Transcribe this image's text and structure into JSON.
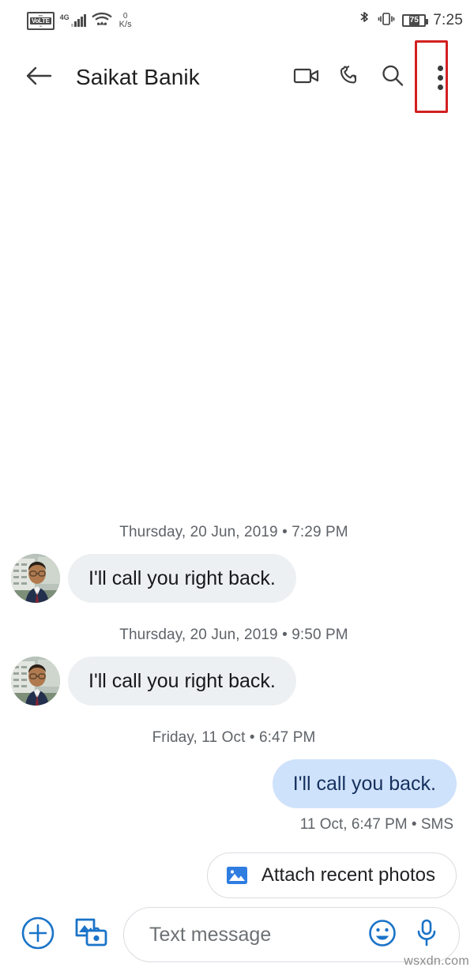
{
  "status_bar": {
    "volte_label_top": "VoLTE",
    "volte_label": "VoLTE",
    "network": "4G",
    "data_rate_value": "0",
    "data_rate_unit": "K/s",
    "battery_level": "75",
    "time": "7:25",
    "icons": [
      "volte-icon",
      "signal-icon",
      "wifi-icon",
      "bluetooth-icon",
      "vibrate-icon",
      "battery-icon"
    ]
  },
  "toolbar": {
    "back_icon": "back-arrow-icon",
    "title": "Saikat Banik",
    "video_call_icon": "video-call-icon",
    "call_icon": "phone-call-icon",
    "search_icon": "search-icon",
    "overflow_icon": "more-options-icon",
    "highlight_color": "#d32020"
  },
  "conversation": {
    "groups": [
      {
        "separator": "Thursday, 20 Jun, 2019 • 7:29 PM",
        "direction": "in",
        "text": "I'll call you right back.",
        "avatar": "contact-avatar",
        "status": ""
      },
      {
        "separator": "Thursday, 20 Jun, 2019 • 9:50 PM",
        "direction": "in",
        "text": "I'll call you right back.",
        "avatar": "contact-avatar",
        "status": ""
      },
      {
        "separator": "Friday, 11 Oct • 6:47 PM",
        "direction": "out",
        "text": "I'll call you back.",
        "avatar": "",
        "status": "11 Oct, 6:47 PM • SMS"
      }
    ],
    "bubble_in_color": "#edf0f2",
    "bubble_out_color": "#cfe2fb"
  },
  "suggestion_chip": {
    "icon": "photo-icon",
    "label": "Attach recent photos"
  },
  "compose": {
    "add_icon": "plus-circle-icon",
    "gallery_icon": "gallery-camera-icon",
    "placeholder": "Text message",
    "value": "",
    "emoji_icon": "emoji-icon",
    "mic_icon": "microphone-icon",
    "accent_color": "#1a73c8"
  },
  "watermark": "wsxdn.com"
}
